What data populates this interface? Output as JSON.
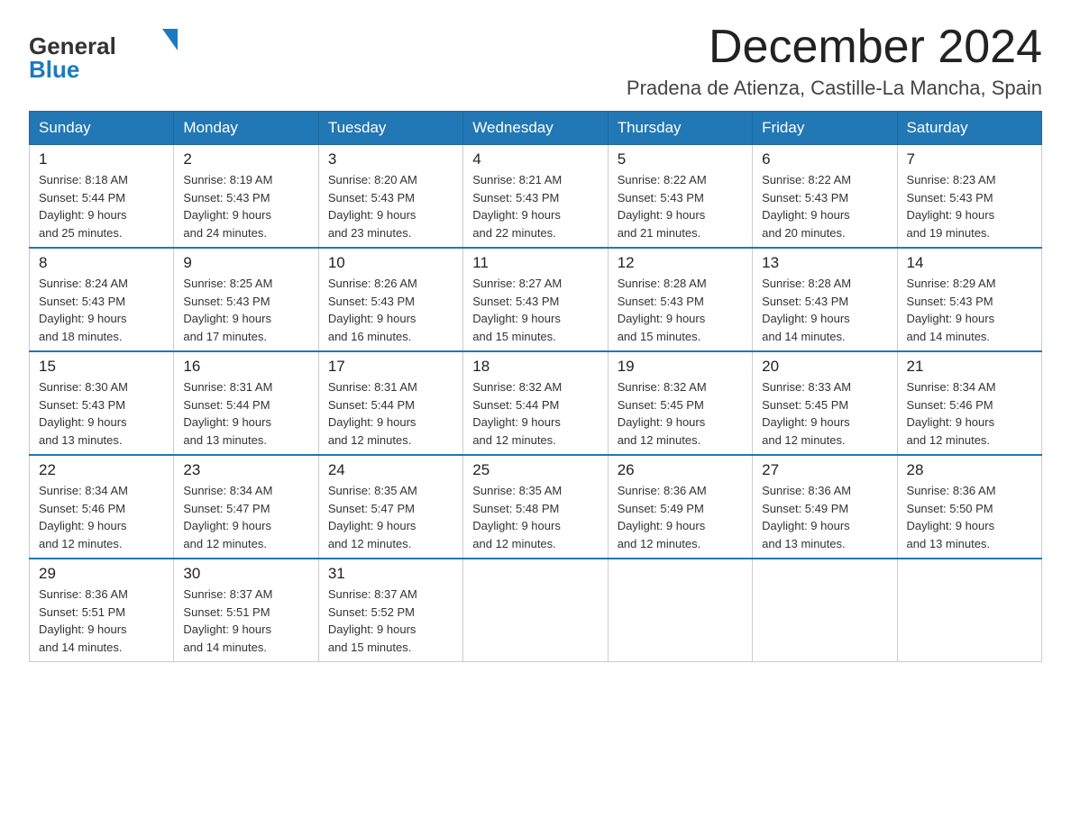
{
  "header": {
    "logo_general": "General",
    "logo_blue": "Blue",
    "month_title": "December 2024",
    "location": "Pradena de Atienza, Castille-La Mancha, Spain"
  },
  "days_of_week": [
    "Sunday",
    "Monday",
    "Tuesday",
    "Wednesday",
    "Thursday",
    "Friday",
    "Saturday"
  ],
  "weeks": [
    [
      {
        "day": "1",
        "sunrise": "8:18 AM",
        "sunset": "5:44 PM",
        "daylight": "9 hours and 25 minutes."
      },
      {
        "day": "2",
        "sunrise": "8:19 AM",
        "sunset": "5:43 PM",
        "daylight": "9 hours and 24 minutes."
      },
      {
        "day": "3",
        "sunrise": "8:20 AM",
        "sunset": "5:43 PM",
        "daylight": "9 hours and 23 minutes."
      },
      {
        "day": "4",
        "sunrise": "8:21 AM",
        "sunset": "5:43 PM",
        "daylight": "9 hours and 22 minutes."
      },
      {
        "day": "5",
        "sunrise": "8:22 AM",
        "sunset": "5:43 PM",
        "daylight": "9 hours and 21 minutes."
      },
      {
        "day": "6",
        "sunrise": "8:22 AM",
        "sunset": "5:43 PM",
        "daylight": "9 hours and 20 minutes."
      },
      {
        "day": "7",
        "sunrise": "8:23 AM",
        "sunset": "5:43 PM",
        "daylight": "9 hours and 19 minutes."
      }
    ],
    [
      {
        "day": "8",
        "sunrise": "8:24 AM",
        "sunset": "5:43 PM",
        "daylight": "9 hours and 18 minutes."
      },
      {
        "day": "9",
        "sunrise": "8:25 AM",
        "sunset": "5:43 PM",
        "daylight": "9 hours and 17 minutes."
      },
      {
        "day": "10",
        "sunrise": "8:26 AM",
        "sunset": "5:43 PM",
        "daylight": "9 hours and 16 minutes."
      },
      {
        "day": "11",
        "sunrise": "8:27 AM",
        "sunset": "5:43 PM",
        "daylight": "9 hours and 15 minutes."
      },
      {
        "day": "12",
        "sunrise": "8:28 AM",
        "sunset": "5:43 PM",
        "daylight": "9 hours and 15 minutes."
      },
      {
        "day": "13",
        "sunrise": "8:28 AM",
        "sunset": "5:43 PM",
        "daylight": "9 hours and 14 minutes."
      },
      {
        "day": "14",
        "sunrise": "8:29 AM",
        "sunset": "5:43 PM",
        "daylight": "9 hours and 14 minutes."
      }
    ],
    [
      {
        "day": "15",
        "sunrise": "8:30 AM",
        "sunset": "5:43 PM",
        "daylight": "9 hours and 13 minutes."
      },
      {
        "day": "16",
        "sunrise": "8:31 AM",
        "sunset": "5:44 PM",
        "daylight": "9 hours and 13 minutes."
      },
      {
        "day": "17",
        "sunrise": "8:31 AM",
        "sunset": "5:44 PM",
        "daylight": "9 hours and 12 minutes."
      },
      {
        "day": "18",
        "sunrise": "8:32 AM",
        "sunset": "5:44 PM",
        "daylight": "9 hours and 12 minutes."
      },
      {
        "day": "19",
        "sunrise": "8:32 AM",
        "sunset": "5:45 PM",
        "daylight": "9 hours and 12 minutes."
      },
      {
        "day": "20",
        "sunrise": "8:33 AM",
        "sunset": "5:45 PM",
        "daylight": "9 hours and 12 minutes."
      },
      {
        "day": "21",
        "sunrise": "8:34 AM",
        "sunset": "5:46 PM",
        "daylight": "9 hours and 12 minutes."
      }
    ],
    [
      {
        "day": "22",
        "sunrise": "8:34 AM",
        "sunset": "5:46 PM",
        "daylight": "9 hours and 12 minutes."
      },
      {
        "day": "23",
        "sunrise": "8:34 AM",
        "sunset": "5:47 PM",
        "daylight": "9 hours and 12 minutes."
      },
      {
        "day": "24",
        "sunrise": "8:35 AM",
        "sunset": "5:47 PM",
        "daylight": "9 hours and 12 minutes."
      },
      {
        "day": "25",
        "sunrise": "8:35 AM",
        "sunset": "5:48 PM",
        "daylight": "9 hours and 12 minutes."
      },
      {
        "day": "26",
        "sunrise": "8:36 AM",
        "sunset": "5:49 PM",
        "daylight": "9 hours and 12 minutes."
      },
      {
        "day": "27",
        "sunrise": "8:36 AM",
        "sunset": "5:49 PM",
        "daylight": "9 hours and 13 minutes."
      },
      {
        "day": "28",
        "sunrise": "8:36 AM",
        "sunset": "5:50 PM",
        "daylight": "9 hours and 13 minutes."
      }
    ],
    [
      {
        "day": "29",
        "sunrise": "8:36 AM",
        "sunset": "5:51 PM",
        "daylight": "9 hours and 14 minutes."
      },
      {
        "day": "30",
        "sunrise": "8:37 AM",
        "sunset": "5:51 PM",
        "daylight": "9 hours and 14 minutes."
      },
      {
        "day": "31",
        "sunrise": "8:37 AM",
        "sunset": "5:52 PM",
        "daylight": "9 hours and 15 minutes."
      },
      null,
      null,
      null,
      null
    ]
  ],
  "labels": {
    "sunrise": "Sunrise: ",
    "sunset": "Sunset: ",
    "daylight": "Daylight: "
  }
}
